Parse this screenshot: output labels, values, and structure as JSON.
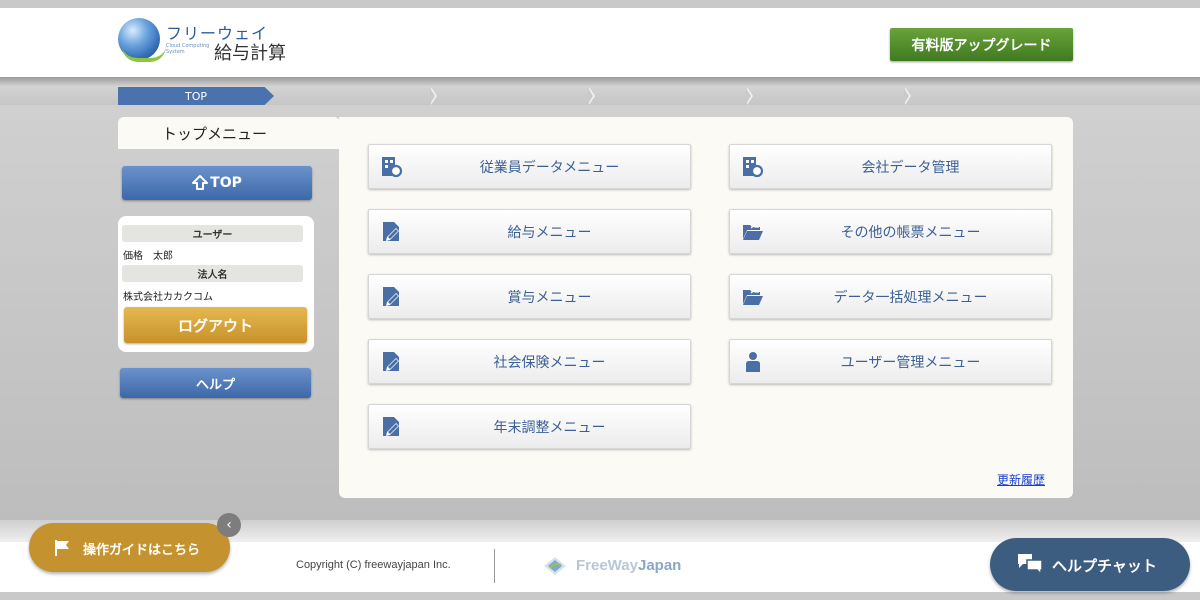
{
  "header": {
    "logo": {
      "kana": "フリーウェイ",
      "sub": "Cloud Computing System",
      "kanji": "給与計算"
    },
    "upgrade_label": "有料版アップグレード"
  },
  "breadcrumb": {
    "current": "TOP"
  },
  "page": {
    "title": "トップメニュー"
  },
  "sidebar": {
    "top_label": "TOP",
    "user_label": "ユーザー",
    "user_name": "価格　太郎",
    "company_label": "法人名",
    "company_name": "株式会社カカクコム",
    "logout_label": "ログアウト",
    "help_label": "ヘルプ"
  },
  "menu": {
    "left": [
      {
        "label": "従業員データメニュー",
        "icon": "building-gear-icon"
      },
      {
        "label": "給与メニュー",
        "icon": "document-pencil-icon"
      },
      {
        "label": "賞与メニュー",
        "icon": "document-pencil-icon"
      },
      {
        "label": "社会保険メニュー",
        "icon": "document-pencil-icon"
      },
      {
        "label": "年末調整メニュー",
        "icon": "document-pencil-icon"
      }
    ],
    "right": [
      {
        "label": "会社データ管理",
        "icon": "building-gear-icon"
      },
      {
        "label": "その他の帳票メニュー",
        "icon": "folder-open-icon"
      },
      {
        "label": "データ一括処理メニュー",
        "icon": "folder-open-icon"
      },
      {
        "label": "ユーザー管理メニュー",
        "icon": "person-icon"
      }
    ],
    "history_link": "更新履歴"
  },
  "footer": {
    "copyright": "Copyright (C) freewayjapan Inc.",
    "brand_free": "FreeWay",
    "brand_japan": "Japan",
    "guide_label": "操作ガイドはこちら",
    "chat_label": "ヘルプチャット",
    "collapse_glyph": "‹"
  },
  "colors": {
    "accent_blue": "#4a72ae",
    "upgrade_green": "#4f8a2a",
    "logout_gold": "#d4a23c",
    "chat_navy": "#3d5d80",
    "icon_blue": "#4a6fa5"
  }
}
